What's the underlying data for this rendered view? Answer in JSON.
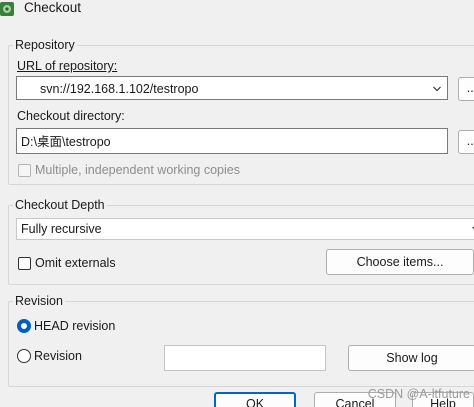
{
  "window": {
    "title": "Checkout",
    "icon": "tortoisesvn-icon"
  },
  "repository": {
    "group_label": "Repository",
    "url_label": "URL of repository:",
    "url_value": "svn://192.168.1.102/testropo",
    "browse_label": "...",
    "dir_label": "Checkout directory:",
    "dir_value": "D:\\桌面\\testropo",
    "dir_browse_label": "...",
    "multiple_label": "Multiple, independent working copies",
    "multiple_checked": false,
    "multiple_enabled": false
  },
  "depth": {
    "group_label": "Checkout Depth",
    "selected": "Fully recursive",
    "omit_externals_label": "Omit externals",
    "omit_externals_checked": false,
    "choose_items_label": "Choose items..."
  },
  "revision": {
    "group_label": "Revision",
    "head_label": "HEAD revision",
    "head_selected": true,
    "revision_label": "Revision",
    "revision_value": "",
    "show_log_label": "Show log"
  },
  "footer": {
    "ok_label": "OK",
    "cancel_label": "Cancel",
    "help_label": "Help"
  },
  "watermark": "CSDN @A-ltfuture",
  "colors": {
    "accent": "#005fb8",
    "default_button_border": "#0067c0",
    "background": "#f0f0f0"
  }
}
